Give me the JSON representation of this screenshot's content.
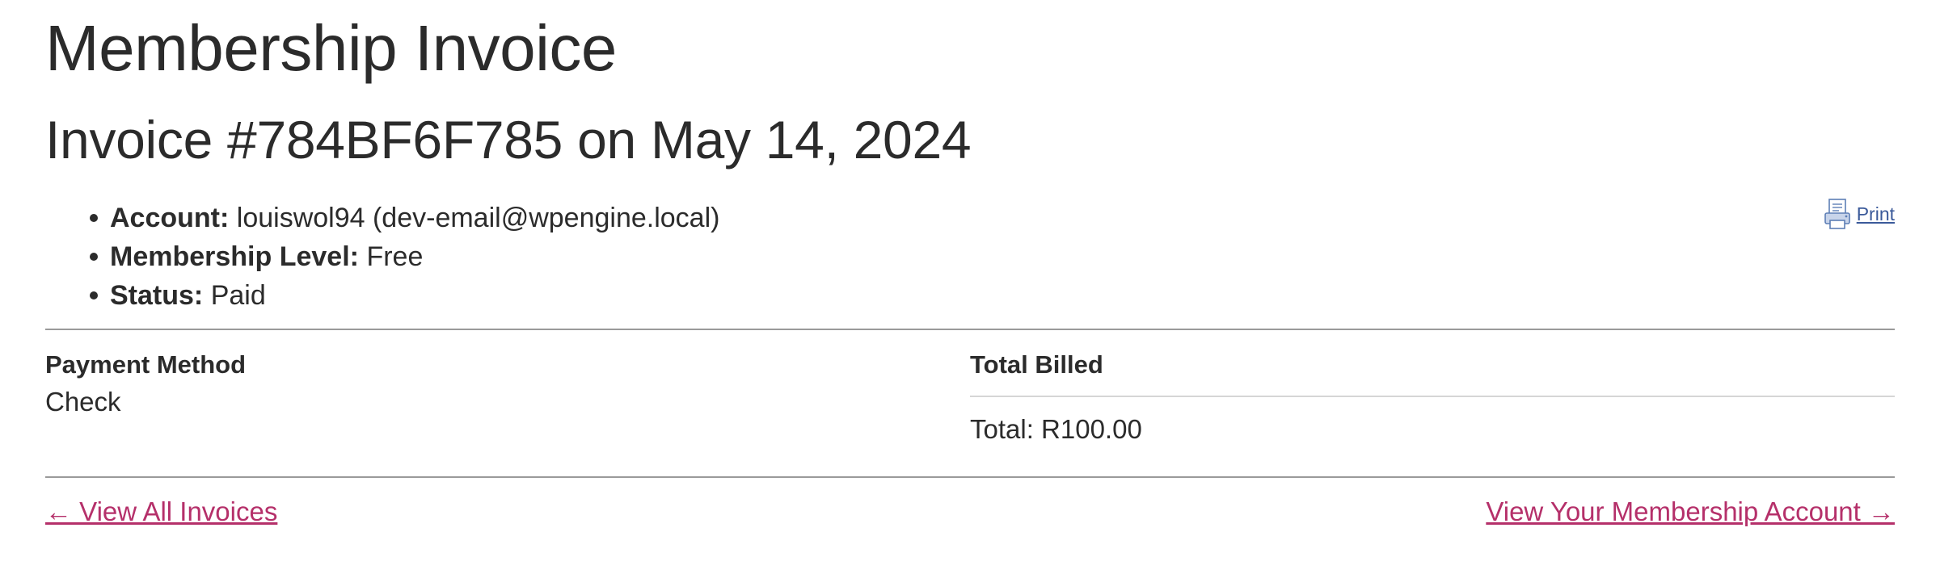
{
  "page": {
    "title": "Membership Invoice",
    "subtitle": "Invoice #784BF6F785 on May 14, 2024"
  },
  "invoice_meta": {
    "account_label": "Account:",
    "account_value": "louiswol94 (dev-email@wpengine.local)",
    "level_label": "Membership Level:",
    "level_value": "Free",
    "status_label": "Status:",
    "status_value": "Paid"
  },
  "print": {
    "label": "Print",
    "icon": "printer-icon"
  },
  "payment": {
    "heading": "Payment Method",
    "value": "Check"
  },
  "billing": {
    "heading": "Total Billed",
    "total": "Total: R100.00"
  },
  "footer": {
    "view_invoices": "← View All Invoices",
    "view_account": "View Your Membership Account →"
  },
  "colors": {
    "text": "#2b2b2b",
    "link_accent": "#b5306a",
    "print_link": "#3b5a9a",
    "rule": "#9a9a9a"
  }
}
